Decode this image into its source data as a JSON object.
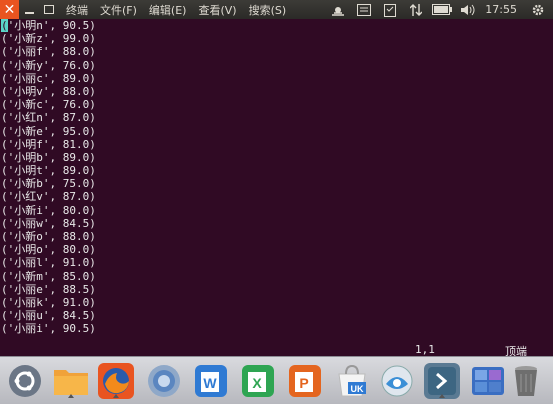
{
  "menubar": {
    "items": [
      {
        "label": "终端"
      },
      {
        "label": "文件(F)"
      },
      {
        "label": "编辑(E)"
      },
      {
        "label": "查看(V)"
      },
      {
        "label": "搜索(S)"
      }
    ],
    "clock": "17:55"
  },
  "terminal": {
    "lines": [
      "('小明n', 90.5)",
      "('小新z', 99.0)",
      "('小丽f', 88.0)",
      "('小新y', 76.0)",
      "('小丽c', 89.0)",
      "('小明v', 88.0)",
      "('小新c', 76.0)",
      "('小红n', 87.0)",
      "('小新e', 95.0)",
      "('小明f', 81.0)",
      "('小明b', 89.0)",
      "('小明t', 89.0)",
      "('小新b', 75.0)",
      "('小红v', 87.0)",
      "('小新i', 80.0)",
      "('小丽w', 84.5)",
      "('小新o', 88.0)",
      "('小明o', 80.0)",
      "('小丽l', 91.0)",
      "('小新m', 85.0)",
      "('小丽e', 88.5)",
      "('小丽k', 91.0)",
      "('小丽u', 84.5)",
      "('小丽i', 90.5)"
    ],
    "status_position": "1,1",
    "status_scroll": "顶端"
  },
  "dock": {
    "items": [
      {
        "name": "ubuntu-logo-icon"
      },
      {
        "name": "files-folder-icon"
      },
      {
        "name": "firefox-icon"
      },
      {
        "name": "chromium-icon"
      },
      {
        "name": "wps-writer-icon"
      },
      {
        "name": "wps-spreadsheets-icon"
      },
      {
        "name": "wps-presentation-icon"
      },
      {
        "name": "ubuntu-kylin-software-icon"
      },
      {
        "name": "update-manager-icon"
      },
      {
        "name": "terminal-icon"
      },
      {
        "name": "workspace-switcher-icon"
      },
      {
        "name": "trash-icon"
      }
    ]
  },
  "colors": {
    "terminal_bg": "#300a24",
    "cursor": "#5ad4c8",
    "accent": "#e95420"
  }
}
